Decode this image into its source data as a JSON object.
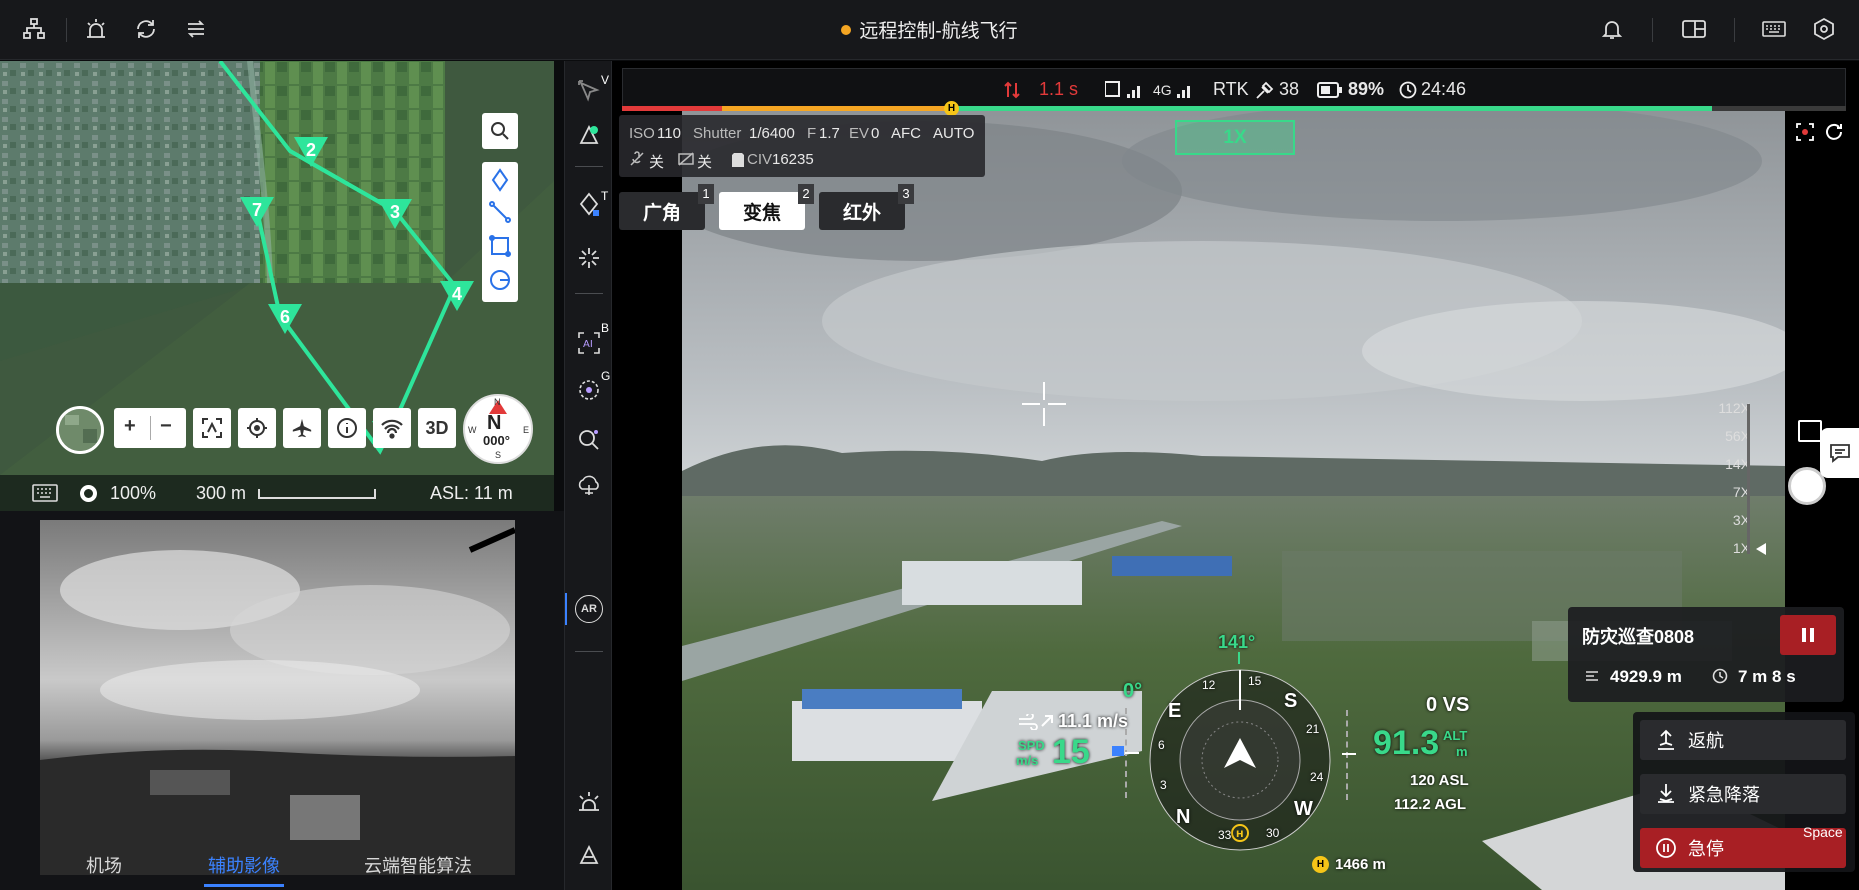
{
  "topbar": {
    "title": "远程控制-航线飞行",
    "left_icons": [
      "topology-icon",
      "alarm-icon",
      "sync-icon",
      "swap-icon"
    ],
    "right_icons": [
      "bell-icon",
      "layout-icon",
      "keyboard-icon",
      "settings-hex-icon"
    ],
    "status_dot_color": "#f5a623"
  },
  "map": {
    "waypoints": [
      "2",
      "3",
      "4",
      "6",
      "7"
    ],
    "battery_pct": "100%",
    "scale": "300 m",
    "asl": "ASL: 11 m",
    "controls": {
      "zoom_in": "+",
      "zoom_out": "−",
      "mode_3d": "3D"
    },
    "compass": {
      "n": "N",
      "heading": "000°",
      "s": "S",
      "w": "W",
      "e": "E"
    }
  },
  "lower_tabs": [
    {
      "label": "机场",
      "active": false
    },
    {
      "label": "辅助影像",
      "active": true
    },
    {
      "label": "云端智能算法",
      "active": false
    }
  ],
  "midbar": {
    "keys": {
      "v": "V",
      "t": "T",
      "b": "B",
      "g": "G"
    },
    "ar_label": "AR"
  },
  "status": {
    "latency": "1.1 s",
    "signal_4g": "4G",
    "rtk_label": "RTK",
    "rtk_sats": "38",
    "battery": "89%",
    "time": "24:46",
    "h_marker": "H",
    "progress_red_color": "#e23a3a",
    "progress_orange_color": "#f5a623",
    "progress_green_color": "#39d98a"
  },
  "camera": {
    "iso_label": "ISO",
    "iso": "110",
    "shutter_label": "Shutter",
    "shutter": "1/6400",
    "f_label": "F",
    "f": "1.7",
    "ev_label": "EV",
    "ev": "0",
    "afc": "AFC",
    "auto": "AUTO",
    "off1": "关",
    "off2": "关",
    "storage": "16235",
    "lenses": [
      {
        "label": "广角",
        "key": "1",
        "selected": false
      },
      {
        "label": "变焦",
        "key": "2",
        "selected": true
      },
      {
        "label": "红外",
        "key": "3",
        "selected": false
      }
    ],
    "zoom_indicator": "1X",
    "zoom_scale": [
      "112X",
      "56X",
      "14X",
      "7X",
      "3X",
      "1X"
    ]
  },
  "hud": {
    "heading": "141°",
    "pitch": "0°",
    "wind_speed": "11.1 m/s",
    "spd_label": "SPD",
    "spd_unit": "m/s",
    "speed": "15",
    "vs": "0 VS",
    "alt": "91.3",
    "alt_label": "ALT",
    "alt_unit": "m",
    "asl": "120 ASL",
    "agl": "112.2 AGL",
    "home_dist": "1466 m",
    "home_marker": "H",
    "compass_marks": [
      "S",
      "21",
      "24",
      "W",
      "30",
      "33",
      "N",
      "3",
      "6",
      "E",
      "12",
      "15"
    ]
  },
  "task": {
    "name": "防灾巡查0808",
    "distance": "4929.9 m",
    "duration": "7 m 8 s"
  },
  "actions": {
    "return": "返航",
    "emergency_land": "紧急降落",
    "stop": "急停",
    "space_hint": "Space"
  }
}
